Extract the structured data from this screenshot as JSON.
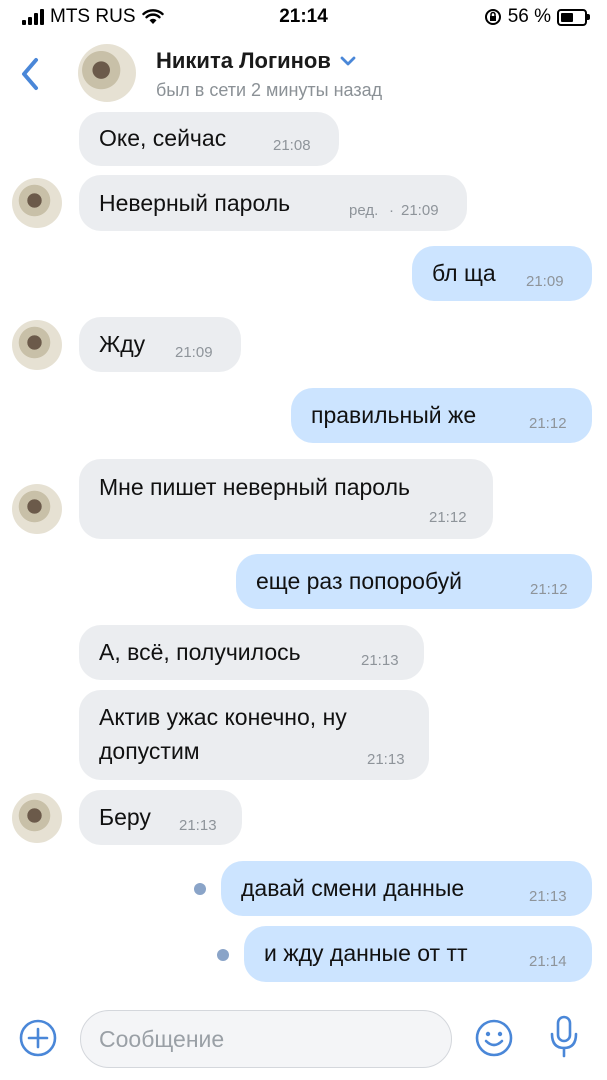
{
  "status": {
    "carrier": "MTS RUS",
    "time": "21:14",
    "battery": "56 %",
    "battery_level": 0.56
  },
  "header": {
    "name": "Никита Логинов",
    "subtitle": "был в сети 2 минуты назад"
  },
  "messages": [
    {
      "dir": "in",
      "text": "Оке, сейчас",
      "time": "21:08"
    },
    {
      "dir": "in",
      "text": "Неверный пароль",
      "edited": "ред.",
      "time": "21:09"
    },
    {
      "dir": "out",
      "text": "бл ща",
      "time": "21:09"
    },
    {
      "dir": "in",
      "text": "Жду",
      "time": "21:09"
    },
    {
      "dir": "out",
      "text": "правильный же",
      "time": "21:12"
    },
    {
      "dir": "in",
      "text": "Мне пишет неверный пароль",
      "time": "21:12"
    },
    {
      "dir": "out",
      "text": "еще раз попоробуй",
      "time": "21:12"
    },
    {
      "dir": "in",
      "text": "А, всё, получилось",
      "time": "21:13"
    },
    {
      "dir": "in",
      "text_line1": "Актив ужас конечно, ну",
      "text_line2": "допустим",
      "time": "21:13"
    },
    {
      "dir": "in",
      "text": "Беру",
      "time": "21:13"
    },
    {
      "dir": "out",
      "text": "давай смени данные",
      "time": "21:13",
      "unread": true
    },
    {
      "dir": "out",
      "text": "и жду данные от тт",
      "time": "21:14",
      "unread": true
    }
  ],
  "composer": {
    "placeholder": "Сообщение"
  },
  "colors": {
    "accent": "#4a87d8",
    "incoming_bubble": "#ebedf0",
    "outgoing_bubble": "#cce4ff"
  }
}
